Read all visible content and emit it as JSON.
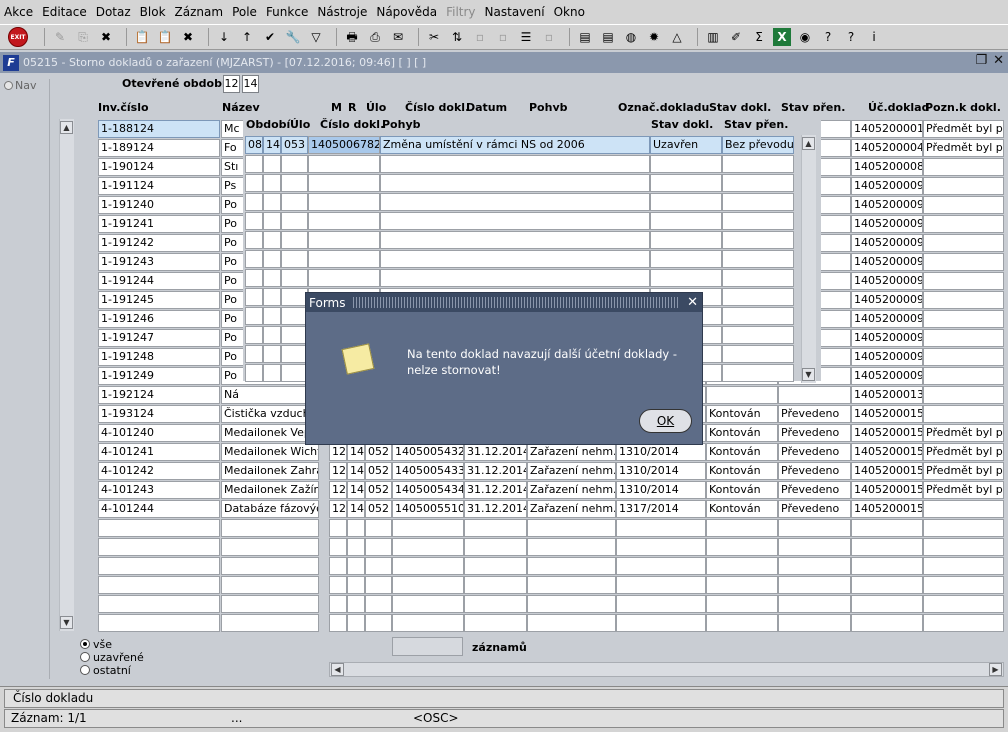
{
  "menu": [
    "Akce",
    "Editace",
    "Dotaz",
    "Blok",
    "Záznam",
    "Pole",
    "Funkce",
    "Nástroje",
    "Nápověda",
    "Filtry",
    "Nastavení",
    "Okno"
  ],
  "toolbar_icons": [
    "exit-icon",
    "sep",
    "disabled-edit-icon",
    "disabled-copy-icon",
    "delete-icon",
    "sep",
    "paste-icon",
    "paste-icon",
    "delete-icon",
    "sep",
    "sort-ascending-icon",
    "sort-descending-icon",
    "checkmark-icon",
    "wrench-icon",
    "filter-icon",
    "sep",
    "print-icon",
    "print-preview-icon",
    "mail-icon",
    "sep",
    "cut-icon",
    "merge-icon",
    "disabled-icon",
    "disabled-icon",
    "list-icon",
    "disabled-icon",
    "sep",
    "document-icon",
    "document-icon",
    "globe-icon",
    "gear-icon",
    "triangle-icon",
    "sep",
    "chart-icon",
    "edit-icon",
    "sigma-icon",
    "excel-icon",
    "world-icon",
    "help-icon",
    "help-icon",
    "info-icon"
  ],
  "window": {
    "title": "05215 - Storno dokladů o zařazení (MJZARST) - [07.12.2016; 09:46]  [ ]  [ ]"
  },
  "nav": {
    "label": "Nav"
  },
  "period": {
    "label": "Otevřené období",
    "values": [
      "12",
      "14"
    ]
  },
  "headers": {
    "inv": "Inv.číslo",
    "name": "Název",
    "m": "M",
    "r": "R",
    "ulo": "Úlo",
    "doc": "Číslo dokl.",
    "date": "Datum",
    "pohyb": "Pohyb",
    "oznac": "Označ.dokladu",
    "stav": "Stav dokl.",
    "stavp": "Stav přen.",
    "ucdok": "Úč.doklad",
    "pozn": "Pozn.k dokl."
  },
  "rows": [
    {
      "inv": "1-188124",
      "name": "Mc",
      "m": "",
      "r": "",
      "ulo": "",
      "doc": "",
      "date": "",
      "pohyb": "",
      "oznac": "",
      "stav": "",
      "stavp": "",
      "ucdok": "1405200001",
      "pozn": "Předmět byl poř"
    },
    {
      "inv": "1-189124",
      "name": "Fo",
      "m": "",
      "r": "",
      "ulo": "",
      "doc": "",
      "date": "",
      "pohyb": "",
      "oznac": "",
      "stav": "",
      "stavp": "",
      "ucdok": "1405200004",
      "pozn": "Předmět byl poř"
    },
    {
      "inv": "1-190124",
      "name": "Stı",
      "m": "",
      "r": "",
      "ulo": "",
      "doc": "",
      "date": "",
      "pohyb": "",
      "oznac": "",
      "stav": "",
      "stavp": "",
      "ucdok": "1405200008",
      "pozn": ""
    },
    {
      "inv": "1-191124",
      "name": "Ps",
      "m": "",
      "r": "",
      "ulo": "",
      "doc": "",
      "date": "",
      "pohyb": "",
      "oznac": "",
      "stav": "",
      "stavp": "",
      "ucdok": "1405200009",
      "pozn": ""
    },
    {
      "inv": "1-191240",
      "name": "Po",
      "m": "",
      "r": "",
      "ulo": "",
      "doc": "",
      "date": "",
      "pohyb": "",
      "oznac": "",
      "stav": "",
      "stavp": "",
      "ucdok": "1405200009",
      "pozn": ""
    },
    {
      "inv": "1-191241",
      "name": "Po",
      "m": "",
      "r": "",
      "ulo": "",
      "doc": "",
      "date": "",
      "pohyb": "",
      "oznac": "",
      "stav": "",
      "stavp": "",
      "ucdok": "1405200009",
      "pozn": ""
    },
    {
      "inv": "1-191242",
      "name": "Po",
      "m": "",
      "r": "",
      "ulo": "",
      "doc": "",
      "date": "",
      "pohyb": "",
      "oznac": "",
      "stav": "",
      "stavp": "",
      "ucdok": "1405200009",
      "pozn": ""
    },
    {
      "inv": "1-191243",
      "name": "Po",
      "m": "",
      "r": "",
      "ulo": "",
      "doc": "",
      "date": "",
      "pohyb": "",
      "oznac": "",
      "stav": "",
      "stavp": "",
      "ucdok": "1405200009",
      "pozn": ""
    },
    {
      "inv": "1-191244",
      "name": "Po",
      "m": "",
      "r": "",
      "ulo": "",
      "doc": "",
      "date": "",
      "pohyb": "",
      "oznac": "",
      "stav": "",
      "stavp": "",
      "ucdok": "1405200009",
      "pozn": ""
    },
    {
      "inv": "1-191245",
      "name": "Po",
      "m": "",
      "r": "",
      "ulo": "",
      "doc": "",
      "date": "",
      "pohyb": "",
      "oznac": "",
      "stav": "",
      "stavp": "",
      "ucdok": "1405200009",
      "pozn": ""
    },
    {
      "inv": "1-191246",
      "name": "Po",
      "m": "",
      "r": "",
      "ulo": "",
      "doc": "",
      "date": "",
      "pohyb": "",
      "oznac": "",
      "stav": "",
      "stavp": "",
      "ucdok": "1405200009",
      "pozn": ""
    },
    {
      "inv": "1-191247",
      "name": "Po",
      "m": "",
      "r": "",
      "ulo": "",
      "doc": "",
      "date": "",
      "pohyb": "",
      "oznac": "",
      "stav": "",
      "stavp": "",
      "ucdok": "1405200009",
      "pozn": ""
    },
    {
      "inv": "1-191248",
      "name": "Po",
      "m": "",
      "r": "",
      "ulo": "",
      "doc": "",
      "date": "",
      "pohyb": "",
      "oznac": "",
      "stav": "",
      "stavp": "",
      "ucdok": "1405200009",
      "pozn": ""
    },
    {
      "inv": "1-191249",
      "name": "Po",
      "m": "",
      "r": "",
      "ulo": "",
      "doc": "",
      "date": "",
      "pohyb": "",
      "oznac": "",
      "stav": "",
      "stavp": "",
      "ucdok": "1405200009",
      "pozn": ""
    },
    {
      "inv": "1-192124",
      "name": "Ná",
      "m": "",
      "r": "",
      "ulo": "",
      "doc": "",
      "date": "",
      "pohyb": "",
      "oznac": "",
      "stav": "",
      "stavp": "",
      "ucdok": "1405200013",
      "pozn": ""
    },
    {
      "inv": "1-193124",
      "name": "Čistička vzduchu",
      "m": "",
      "r": "",
      "ulo": "",
      "doc": "",
      "date": "",
      "pohyb": "",
      "oznac": "",
      "stav": "Kontován",
      "stavp": "Převedeno",
      "ucdok": "1405200015",
      "pozn": ""
    },
    {
      "inv": "4-101240",
      "name": "Medailonek Vepř",
      "m": "",
      "r": "",
      "ulo": "",
      "doc": "",
      "date": "",
      "pohyb": "",
      "oznac": "",
      "stav": "Kontován",
      "stavp": "Převedeno",
      "ucdok": "1405200015",
      "pozn": "Předmět byl poř"
    },
    {
      "inv": "4-101241",
      "name": "Medailonek Wichter",
      "m": "12",
      "r": "14",
      "ulo": "052",
      "doc": "1405005432",
      "date": "31.12.2014",
      "pohyb": "Zařazení nehm.ma",
      "oznac": "1310/2014",
      "stav": "Kontován",
      "stavp": "Převedeno",
      "ucdok": "1405200015",
      "pozn": "Předmět byl poř"
    },
    {
      "inv": "4-101242",
      "name": "Medailonek Zahradr",
      "m": "12",
      "r": "14",
      "ulo": "052",
      "doc": "1405005433",
      "date": "31.12.2014",
      "pohyb": "Zařazení nehm.ma",
      "oznac": "1310/2014",
      "stav": "Kontován",
      "stavp": "Převedeno",
      "ucdok": "1405200015",
      "pozn": "Předmět byl poř"
    },
    {
      "inv": "4-101243",
      "name": "Medailonek Zažímal",
      "m": "12",
      "r": "14",
      "ulo": "052",
      "doc": "1405005434",
      "date": "31.12.2014",
      "pohyb": "Zařazení nehm.ma",
      "oznac": "1310/2014",
      "stav": "Kontován",
      "stavp": "Převedeno",
      "ucdok": "1405200015",
      "pozn": "Předmět byl poř"
    },
    {
      "inv": "4-101244",
      "name": "Databáze fázových",
      "m": "12",
      "r": "14",
      "ulo": "052",
      "doc": "1405005510",
      "date": "31.12.2014",
      "pohyb": "Zařazení nehm.ma",
      "oznac": "1317/2014",
      "stav": "Kontován",
      "stavp": "Převedeno",
      "ucdok": "1405200015",
      "pozn": ""
    }
  ],
  "subform": {
    "headers": {
      "obdobi": "Období",
      "ulo": "Úlo",
      "doc": "Číslo dokl.",
      "pohyb": "Pohyb",
      "stav": "Stav dokl.",
      "stavp": "Stav přen."
    },
    "row": {
      "m": "08",
      "r": "14",
      "ulo": "053",
      "doc": "1405006782",
      "pohyb": "Změna umístění v rámci NS od 2006",
      "stav": "Uzavřen",
      "stavp": "Bez převodu do"
    }
  },
  "filter": {
    "options": [
      "vše",
      "uzavřené",
      "ostatní"
    ],
    "selected": "vše"
  },
  "count": {
    "label": "záznamů",
    "value": ""
  },
  "dialog": {
    "title": "Forms",
    "message": "Na tento doklad navazují další účetní doklady - nelze stornovat!",
    "ok": "OK"
  },
  "status": {
    "field": "Číslo dokladu",
    "record": "Záznam: 1/1",
    "mid": "...",
    "osc": "<OSC>"
  }
}
